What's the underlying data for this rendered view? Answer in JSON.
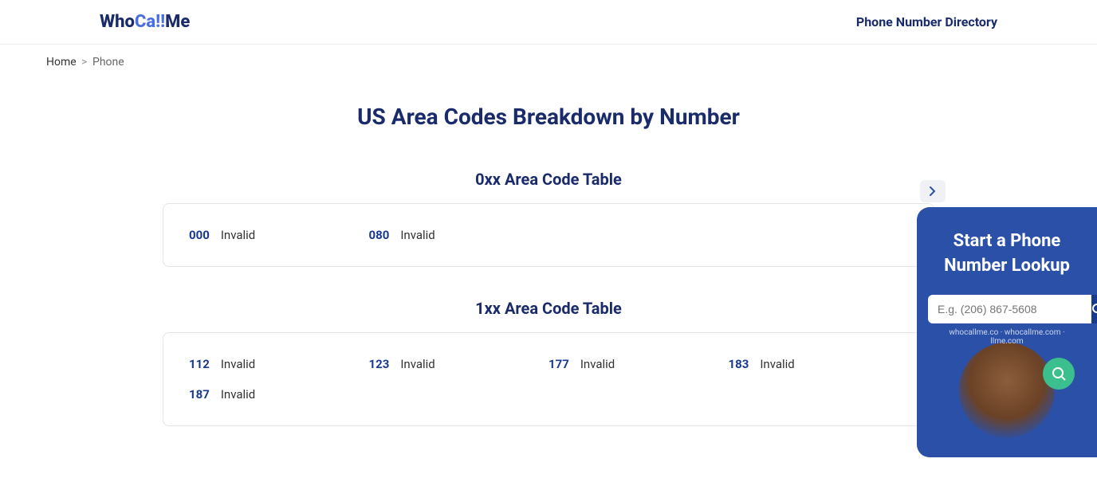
{
  "header": {
    "logo_part1": "Who",
    "logo_part2": "Ca!!",
    "logo_part3": "Me",
    "nav_link": "Phone Number Directory"
  },
  "breadcrumb": {
    "home": "Home",
    "sep": ">",
    "current": "Phone"
  },
  "page_title": "US Area Codes Breakdown by Number",
  "tables": [
    {
      "title": "0xx Area Code Table",
      "codes": [
        {
          "num": "000",
          "label": "Invalid"
        },
        {
          "num": "080",
          "label": "Invalid"
        }
      ]
    },
    {
      "title": "1xx Area Code Table",
      "codes": [
        {
          "num": "112",
          "label": "Invalid"
        },
        {
          "num": "123",
          "label": "Invalid"
        },
        {
          "num": "177",
          "label": "Invalid"
        },
        {
          "num": "183",
          "label": "Invalid"
        },
        {
          "num": "187",
          "label": "Invalid"
        }
      ]
    }
  ],
  "sidebar": {
    "title": "Start a Phone Number Lookup",
    "placeholder": "E.g. (206) 867-5608",
    "circle_text": "whocallme.co · whocallme.com · llme.com"
  }
}
